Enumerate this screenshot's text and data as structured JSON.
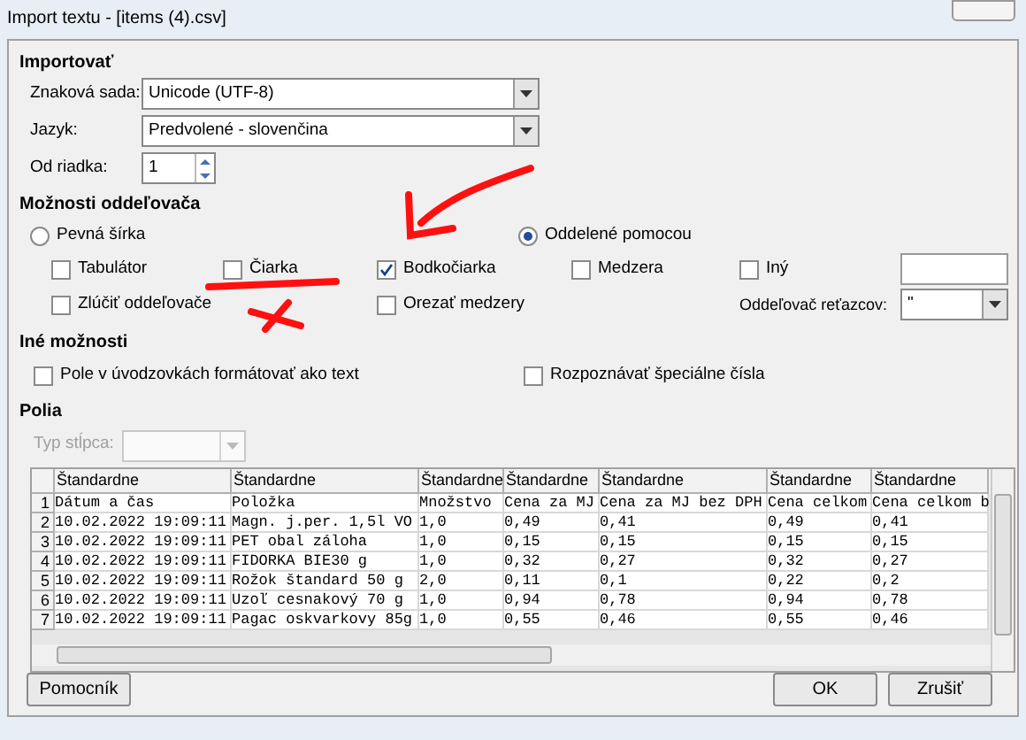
{
  "window": {
    "title": "Import textu - [items (4).csv]"
  },
  "import": {
    "heading": "Importovať",
    "fields": [
      {
        "kind": "combo",
        "label": "Znaková sada:",
        "value": "Unicode (UTF-8)"
      },
      {
        "kind": "combo",
        "label": "Jazyk:",
        "value": "Predvolené - slovenčina"
      },
      {
        "kind": "spin",
        "label": "Od riadka:",
        "value": "1"
      }
    ]
  },
  "separator_options": {
    "heading": "Možnosti oddeľovača",
    "modes": [
      {
        "label": "Pevná šírka",
        "selected": false
      },
      {
        "label": "Oddelené pomocou",
        "selected": true
      }
    ],
    "separators": [
      {
        "label": "Tabulátor",
        "checked": false
      },
      {
        "label": "Čiarka",
        "checked": false
      },
      {
        "label": "Bodkočiarka",
        "checked": true
      },
      {
        "label": "Medzera",
        "checked": false
      },
      {
        "label": "Iný",
        "checked": false
      }
    ],
    "merge": {
      "label": "Zlúčiť oddeľovače",
      "checked": false
    },
    "trim": {
      "label": "Orezať medzery",
      "checked": false
    },
    "string_delimiter": {
      "label": "Oddeľovač reťazcov:",
      "value": "\""
    }
  },
  "other_options": {
    "heading": "Iné možnosti",
    "options": [
      {
        "label": "Pole v úvodzovkách formátovať ako text",
        "checked": false
      },
      {
        "label": "Rozpoznávať špeciálne čísla",
        "checked": false
      }
    ]
  },
  "fields": {
    "heading": "Polia",
    "column_type": {
      "label": "Typ stĺpca:",
      "disabled": true
    },
    "grid": {
      "columns": [
        "Štandardne",
        "Štandardne",
        "Štandardne",
        "Štandardne",
        "Štandardne",
        "Štandardne",
        "Štandardne"
      ],
      "rows": [
        {
          "number": "1",
          "cells": [
            "Dátum a čas",
            "Položka",
            "Množstvo",
            "Cena za MJ",
            "Cena za MJ bez DPH",
            "Cena celkom",
            "Cena celkom b"
          ]
        },
        {
          "number": "2",
          "cells": [
            "10.02.2022 19:09:11",
            "Magn. j.per. 1,5l VO",
            "1,0",
            "0,49",
            "0,41",
            "0,49",
            "0,41"
          ]
        },
        {
          "number": "3",
          "cells": [
            "10.02.2022 19:09:11",
            "PET obal záloha",
            "1,0",
            "0,15",
            "0,15",
            "0,15",
            "0,15"
          ]
        },
        {
          "number": "4",
          "cells": [
            "10.02.2022 19:09:11",
            "FIDORKA BIE30 g",
            "1,0",
            "0,32",
            "0,27",
            "0,32",
            "0,27"
          ]
        },
        {
          "number": "5",
          "cells": [
            "10.02.2022 19:09:11",
            "Rožok štandard 50 g",
            "2,0",
            "0,11",
            "0,1",
            "0,22",
            "0,2"
          ]
        },
        {
          "number": "6",
          "cells": [
            "10.02.2022 19:09:11",
            "Uzoľ cesnakový 70 g",
            "1,0",
            "0,94",
            "0,78",
            "0,94",
            "0,78"
          ]
        },
        {
          "number": "7",
          "cells": [
            "10.02.2022 19:09:11",
            "Pagac oskvarkovy 85g",
            "1,0",
            "0,55",
            "0,46",
            "0,55",
            "0,46"
          ]
        }
      ]
    }
  },
  "buttons": [
    {
      "label": "Pomocník"
    },
    {
      "label": "OK"
    },
    {
      "label": "Zrušiť"
    }
  ]
}
